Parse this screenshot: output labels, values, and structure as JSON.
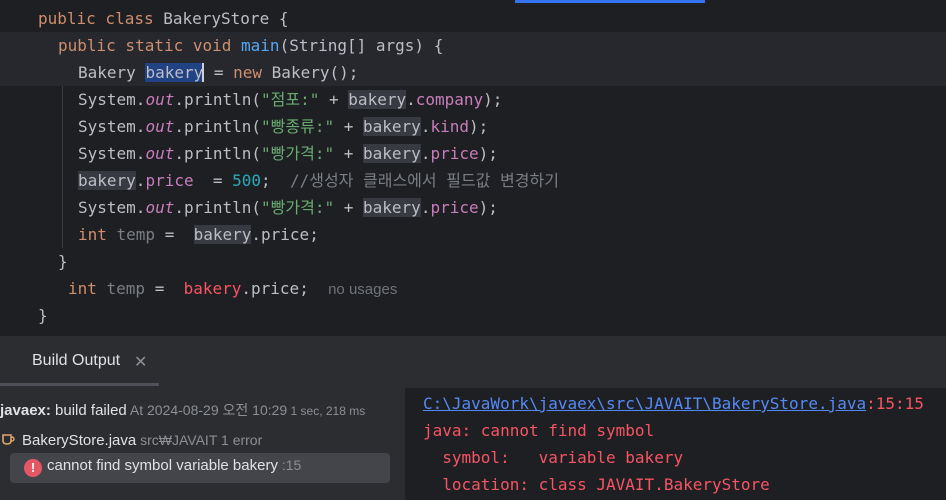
{
  "editor": {
    "code": {
      "l1_kw": "public class ",
      "l1_name": "BakeryStore {",
      "l2_kw": "public static void ",
      "l2_fn": "main",
      "l2_rest": "(String[] args) {",
      "l3_type": "Bakery ",
      "l3_var": "bakery",
      "l3_eq": " = ",
      "l3_new": "new ",
      "l3_rest": "Bakery();",
      "sys": "System.",
      "out": "out",
      "println_open": ".println(",
      "plus": " + ",
      "var": "bakery",
      "dot": ".",
      "close": ");",
      "l4_str": "\"점포:\"",
      "l4_field": "company",
      "l5_str": "\"빵종류:\"",
      "l5_field": "kind",
      "l6_str": "\"빵가격:\"",
      "l6_field": "price",
      "l7_field": "price",
      "l7_eq": "  = ",
      "l7_num": "500",
      "l7_semi": ";  ",
      "l7_comment": "//생성자 클래스에서 필드값 변경하기",
      "l8_str": "\"빵가격:\"",
      "l8_field": "price",
      "l9_kw": "int ",
      "l9_var": "temp",
      "l9_eq": " =  ",
      "l9_rest": ".price;",
      "l10": "}",
      "l11_kw": "int ",
      "l11_var": "temp",
      "l11_eq": " =  ",
      "l11_err": "bakery",
      "l11_rest": ".price;",
      "l11_hint": "no usages",
      "l12": "}"
    }
  },
  "panel": {
    "tab_label": "Build Output",
    "close_glyph": "✕"
  },
  "tree": {
    "root_project": "javaex:",
    "root_status": " build failed",
    "root_time": " At 2024-08-29 오전 10:29",
    "root_duration": " 1 sec, 218 ms",
    "file_name": "BakeryStore.java",
    "file_path": " src₩JAVAIT",
    "file_errors": " 1 error",
    "error_text": "cannot find symbol variable bakery",
    "error_line": " :15"
  },
  "console": {
    "path": "C:\\JavaWork\\javaex\\src\\JAVAIT\\BakeryStore.java",
    "pos": ":15:15",
    "line2": "java: cannot find symbol",
    "line3": "  symbol:   variable bakery",
    "line4": "  location: class JAVAIT.BakeryStore"
  },
  "colors": {
    "background": "#1e1f22",
    "keyword": "#cf8e6d",
    "function": "#56a8f5",
    "string": "#6aab73",
    "field": "#c77dbb",
    "error": "#f75464",
    "link": "#548af7"
  },
  "icons": [
    "java-file-icon",
    "error-icon",
    "close-icon"
  ]
}
